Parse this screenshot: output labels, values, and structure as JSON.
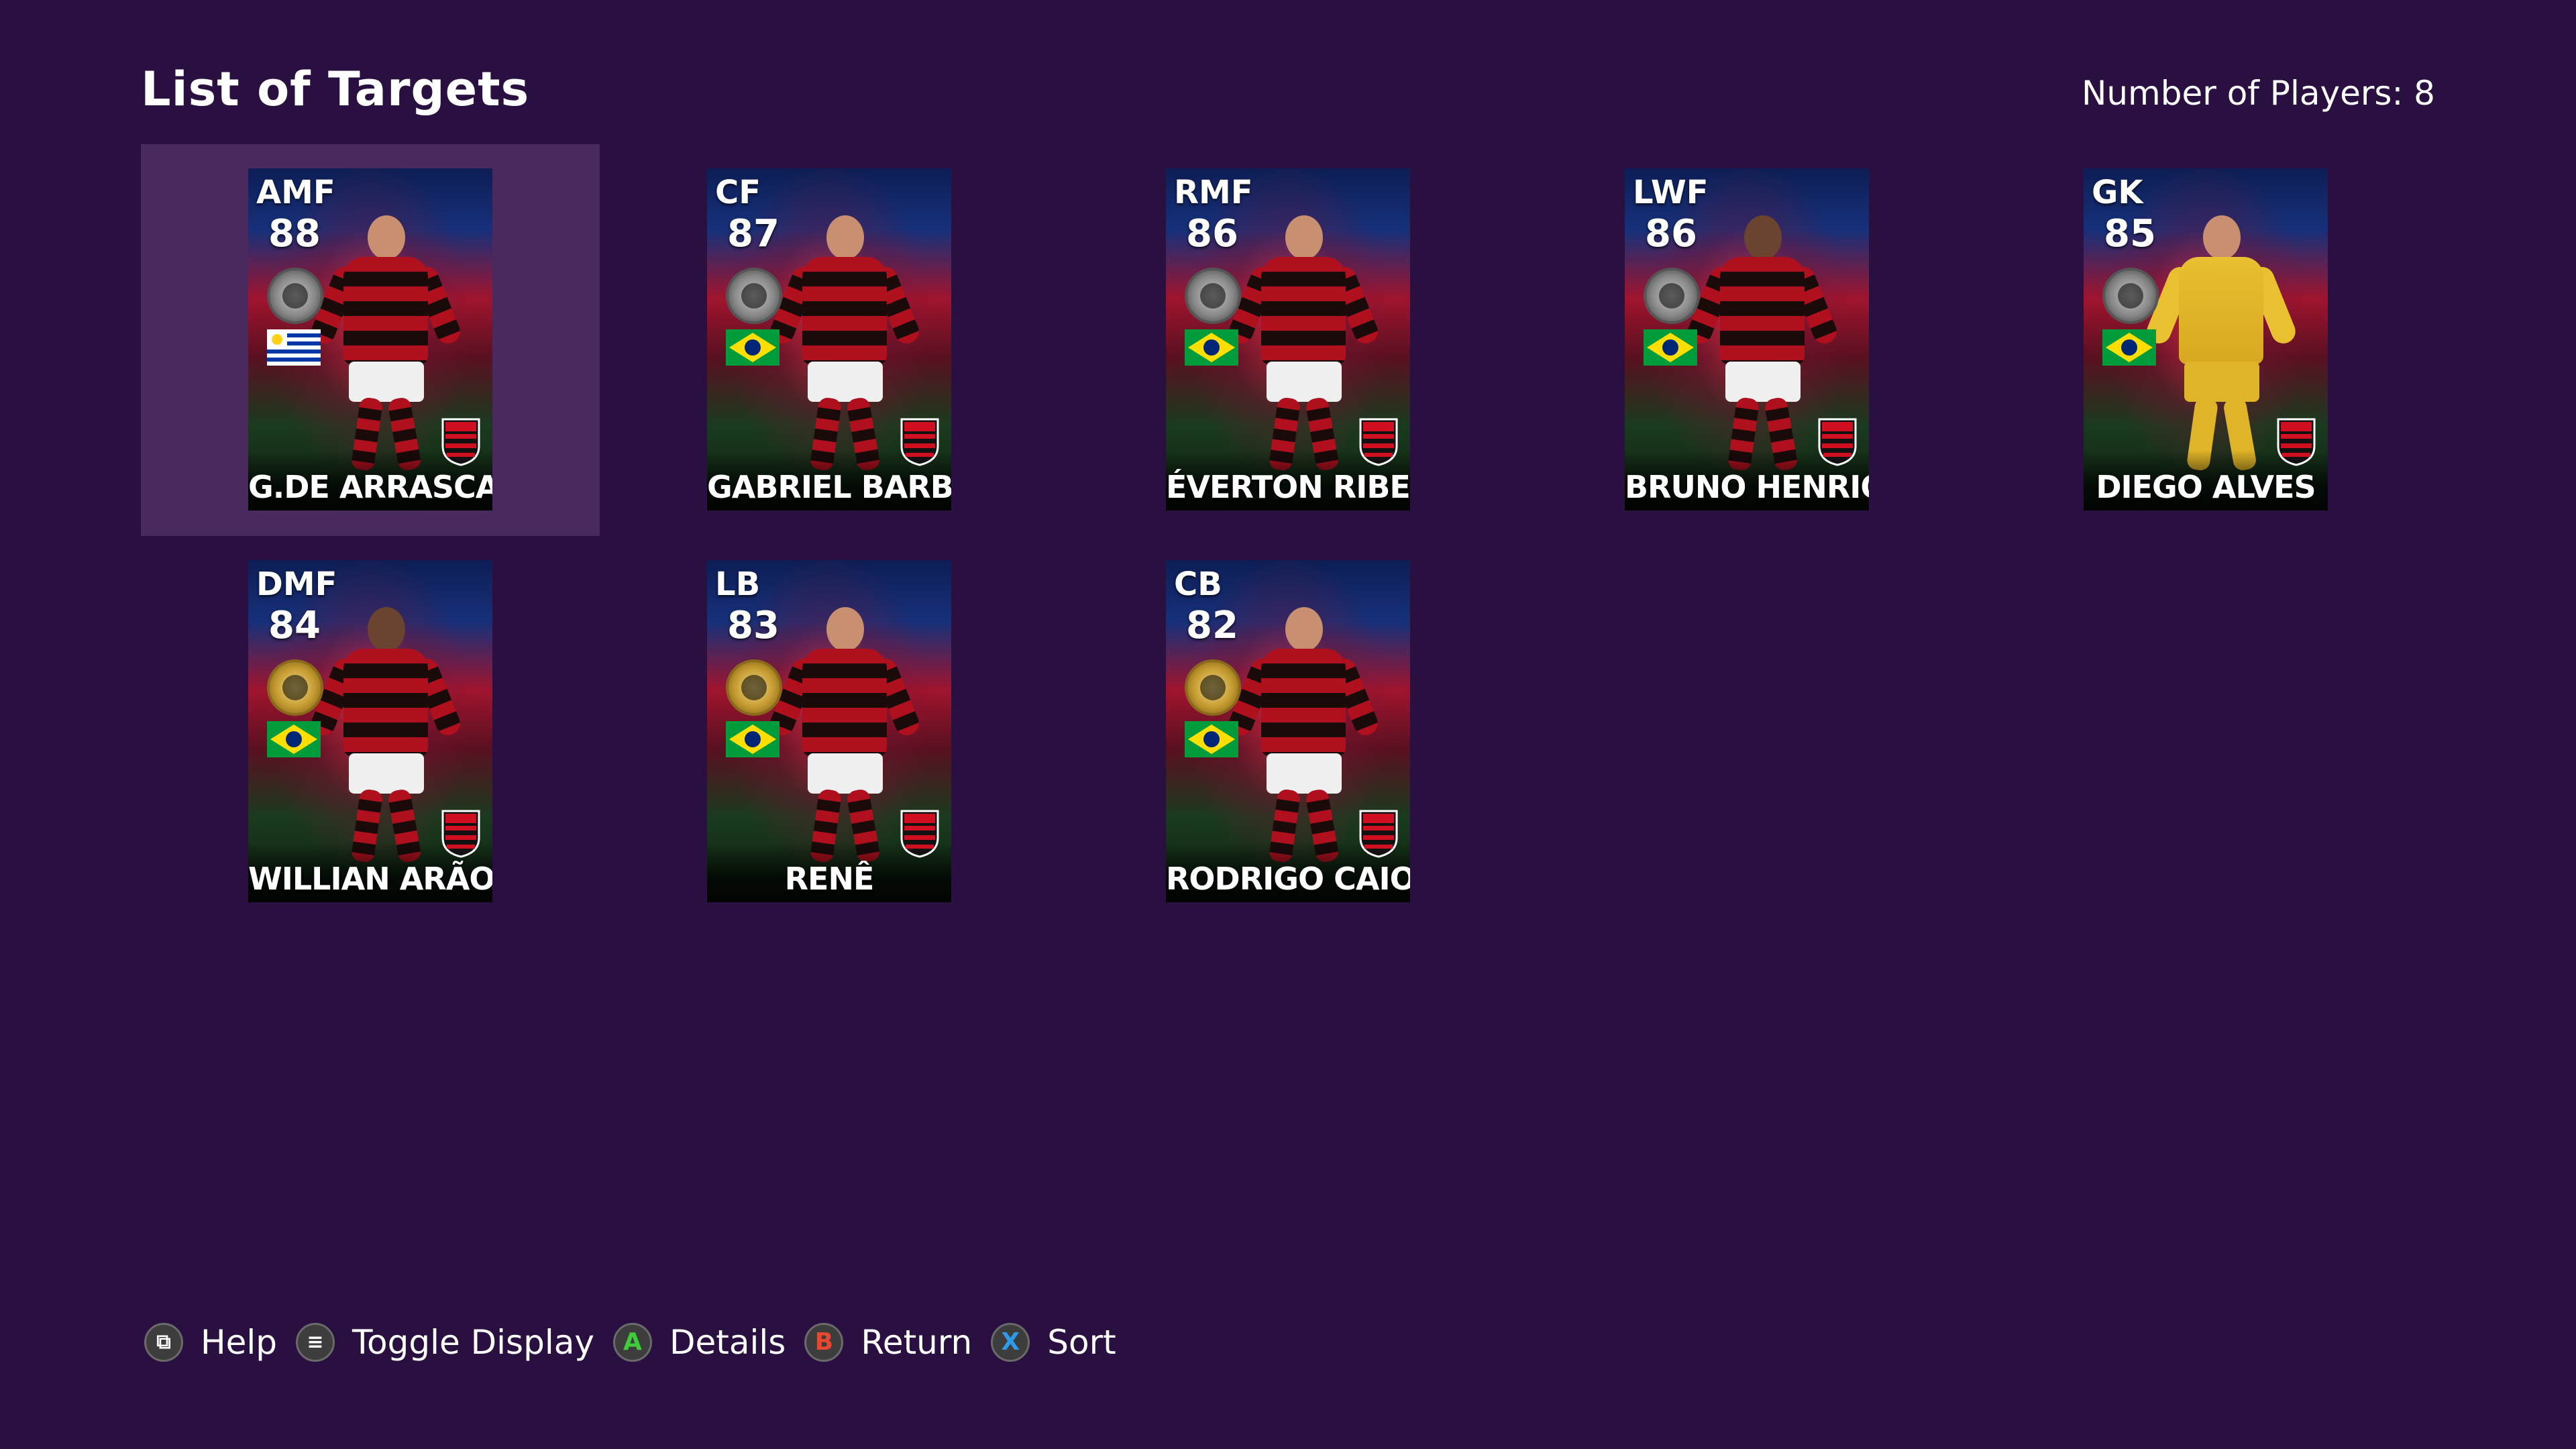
{
  "header": {
    "title": "List of Targets",
    "player_count": "Number of Players: 8"
  },
  "players": [
    {
      "position": "AMF",
      "rating": "88",
      "name": "G.DE ARRASCAETA",
      "flag": "uruguay",
      "badge": "silver",
      "selected": true
    },
    {
      "position": "CF",
      "rating": "87",
      "name": "GABRIEL BARBOSA",
      "flag": "brazil",
      "badge": "silver"
    },
    {
      "position": "RMF",
      "rating": "86",
      "name": "ÉVERTON RIBEIRO",
      "flag": "brazil",
      "badge": "silver"
    },
    {
      "position": "LWF",
      "rating": "86",
      "name": "BRUNO HENRIQUE",
      "flag": "brazil",
      "badge": "silver"
    },
    {
      "position": "GK",
      "rating": "85",
      "name": "DIEGO ALVES",
      "flag": "brazil",
      "badge": "silver",
      "goalkeeper": true
    },
    {
      "position": "DMF",
      "rating": "84",
      "name": "WILLIAN ARÃO",
      "flag": "brazil",
      "badge": "gold"
    },
    {
      "position": "LB",
      "rating": "83",
      "name": "RENÊ",
      "flag": "brazil",
      "badge": "gold"
    },
    {
      "position": "CB",
      "rating": "82",
      "name": "RODRIGO CAIO",
      "flag": "brazil",
      "badge": "gold"
    }
  ],
  "footer": {
    "help_label": "Help",
    "help_icon": "view-button-icon",
    "toggle_label": "Toggle Display",
    "toggle_icon": "menu-button-icon",
    "details_label": "Details",
    "details_button": "A",
    "return_label": "Return",
    "return_button": "B",
    "sort_label": "Sort",
    "sort_button": "X"
  },
  "colors": {
    "background": "#2a1040",
    "selected_slot": "#4a2a5e",
    "button_a": "#3ecc3a",
    "button_b": "#e84830",
    "button_x": "#2e9ae8"
  }
}
